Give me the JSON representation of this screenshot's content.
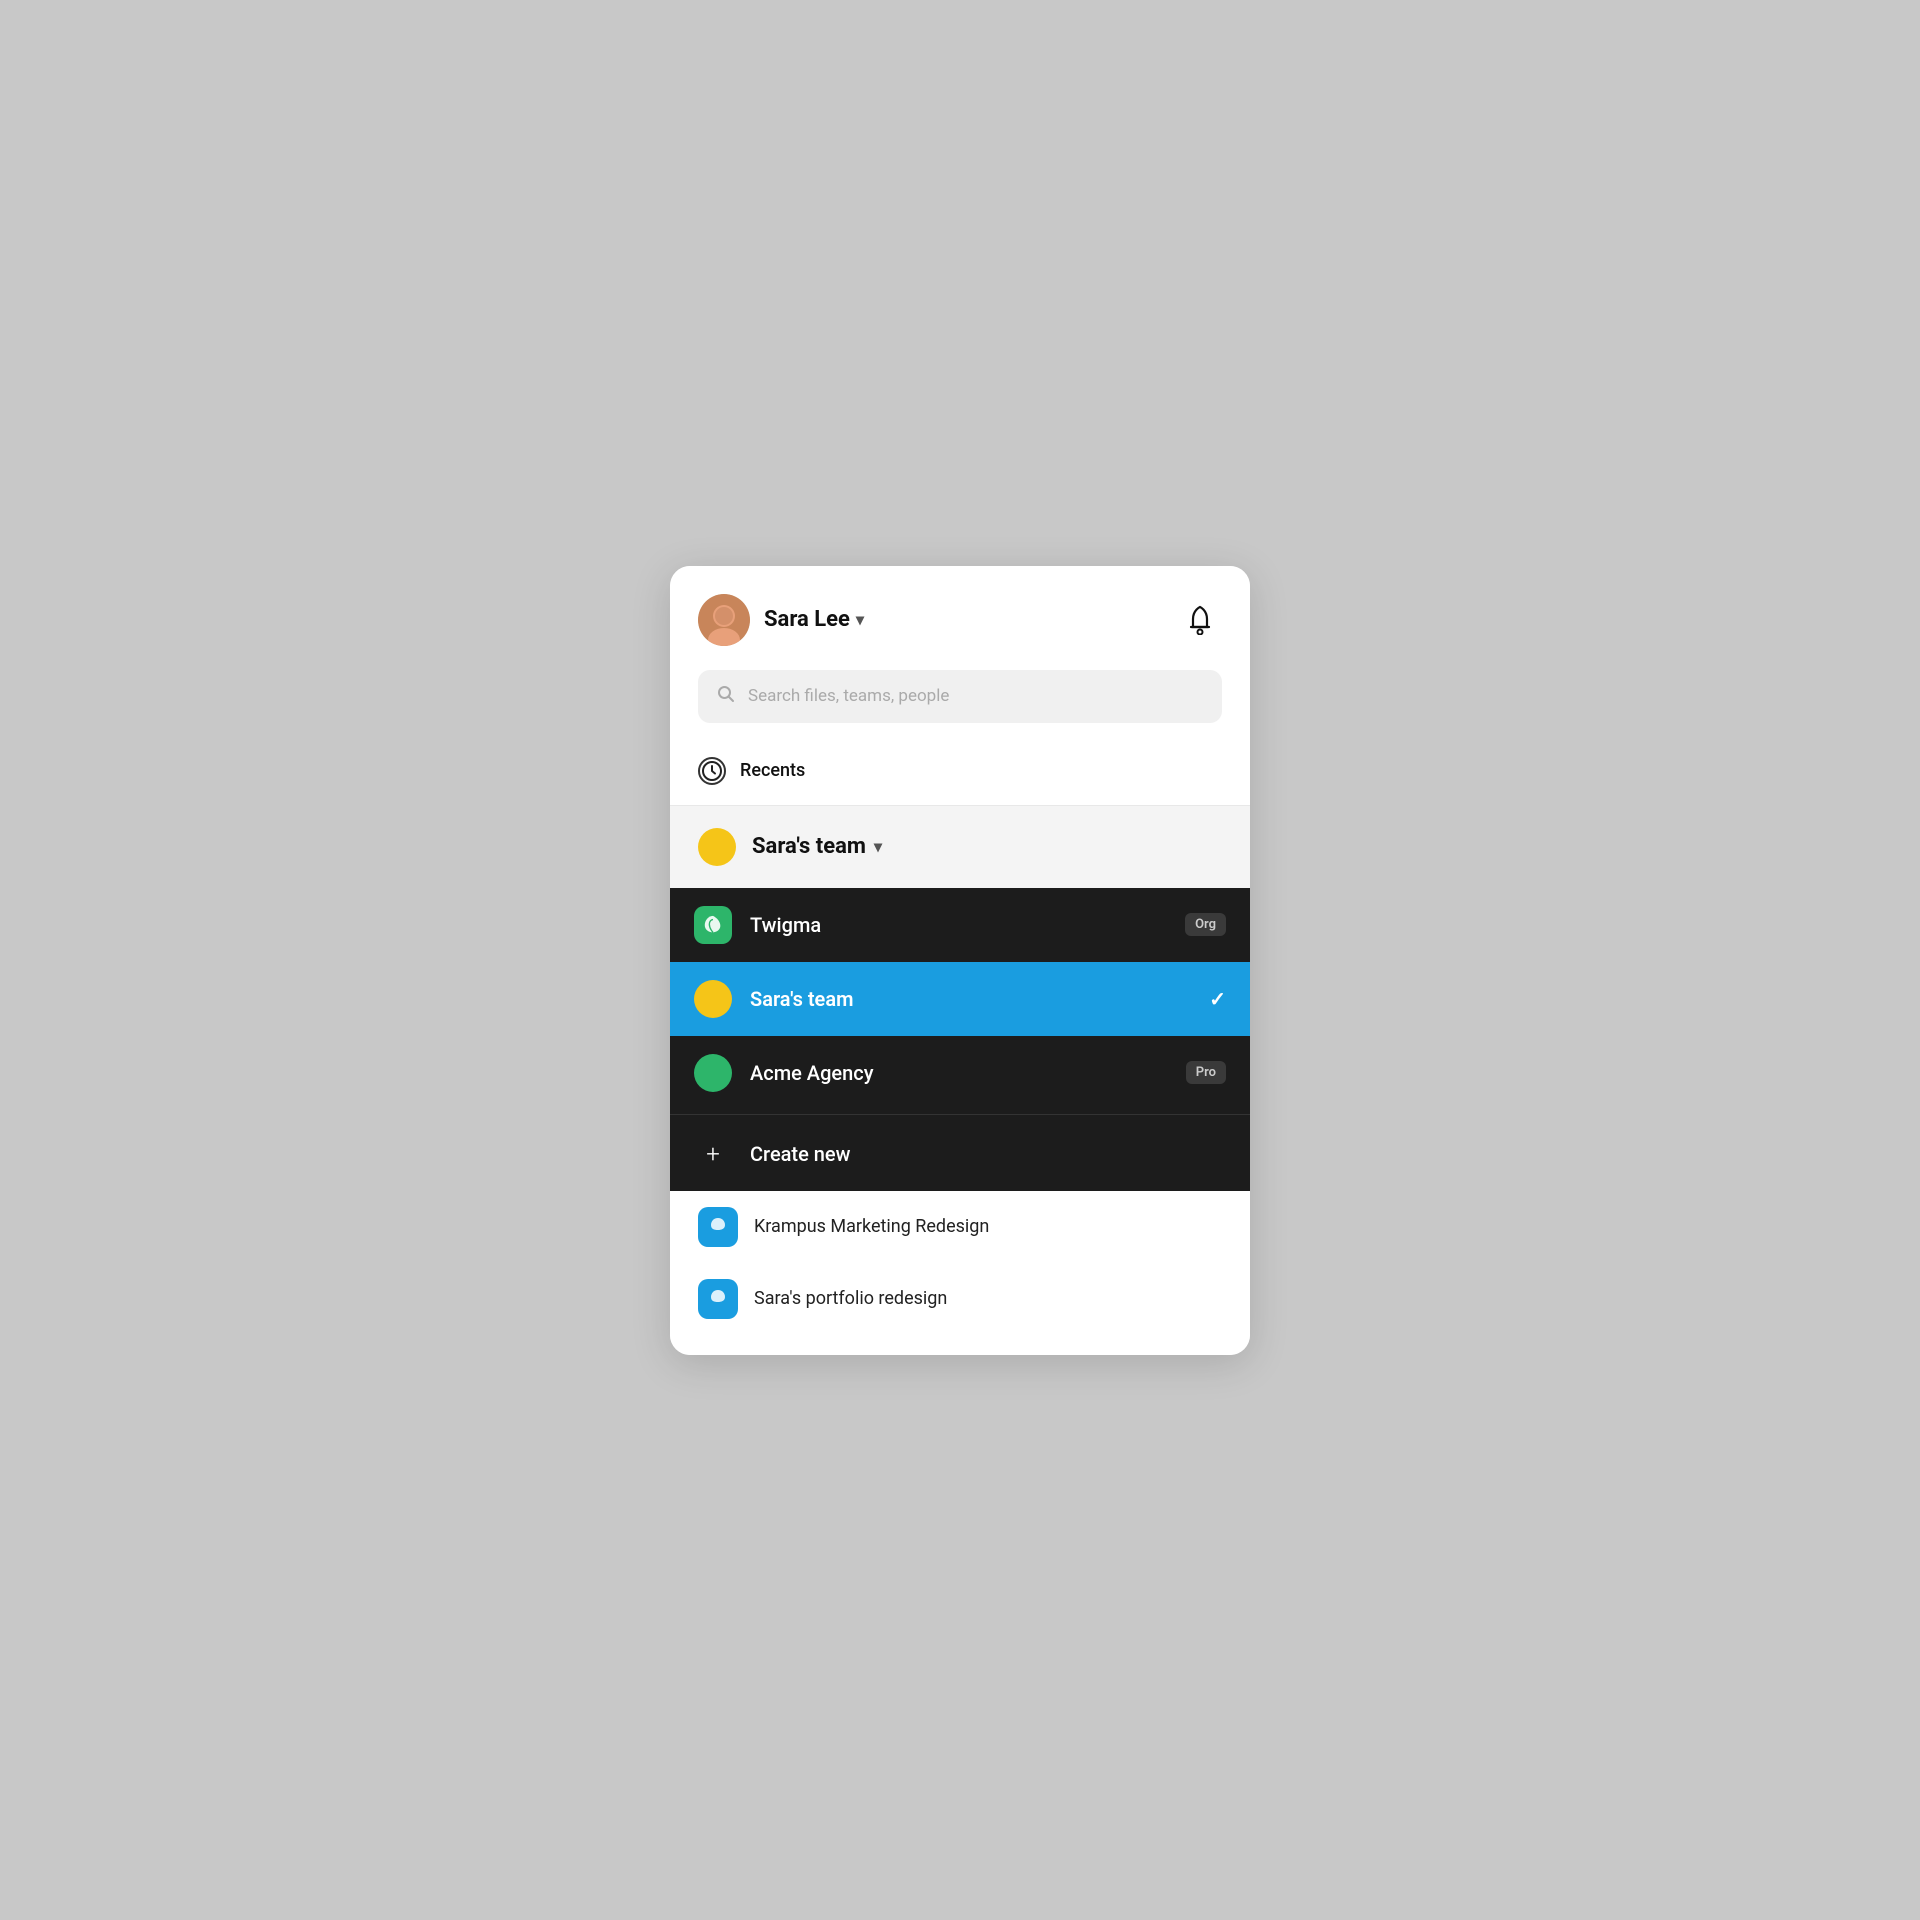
{
  "header": {
    "user_name": "Sara Lee",
    "chevron": "▾",
    "search_placeholder": "Search files, teams, people"
  },
  "recents": {
    "label": "Recents"
  },
  "team_selector": {
    "current_team": "Sara's team",
    "chevron": "▾"
  },
  "dropdown": {
    "items": [
      {
        "id": "twigma",
        "label": "Twigma",
        "badge": "Org",
        "type": "org",
        "active": false
      },
      {
        "id": "saras-team",
        "label": "Sara's team",
        "badge": null,
        "type": "personal",
        "active": true
      },
      {
        "id": "acme-agency",
        "label": "Acme Agency",
        "badge": "Pro",
        "type": "agency",
        "active": false
      }
    ],
    "create_new_label": "Create new"
  },
  "file_list": [
    {
      "label": "Krampus Marketing Redesign"
    },
    {
      "label": "Sara's portfolio redesign"
    }
  ]
}
